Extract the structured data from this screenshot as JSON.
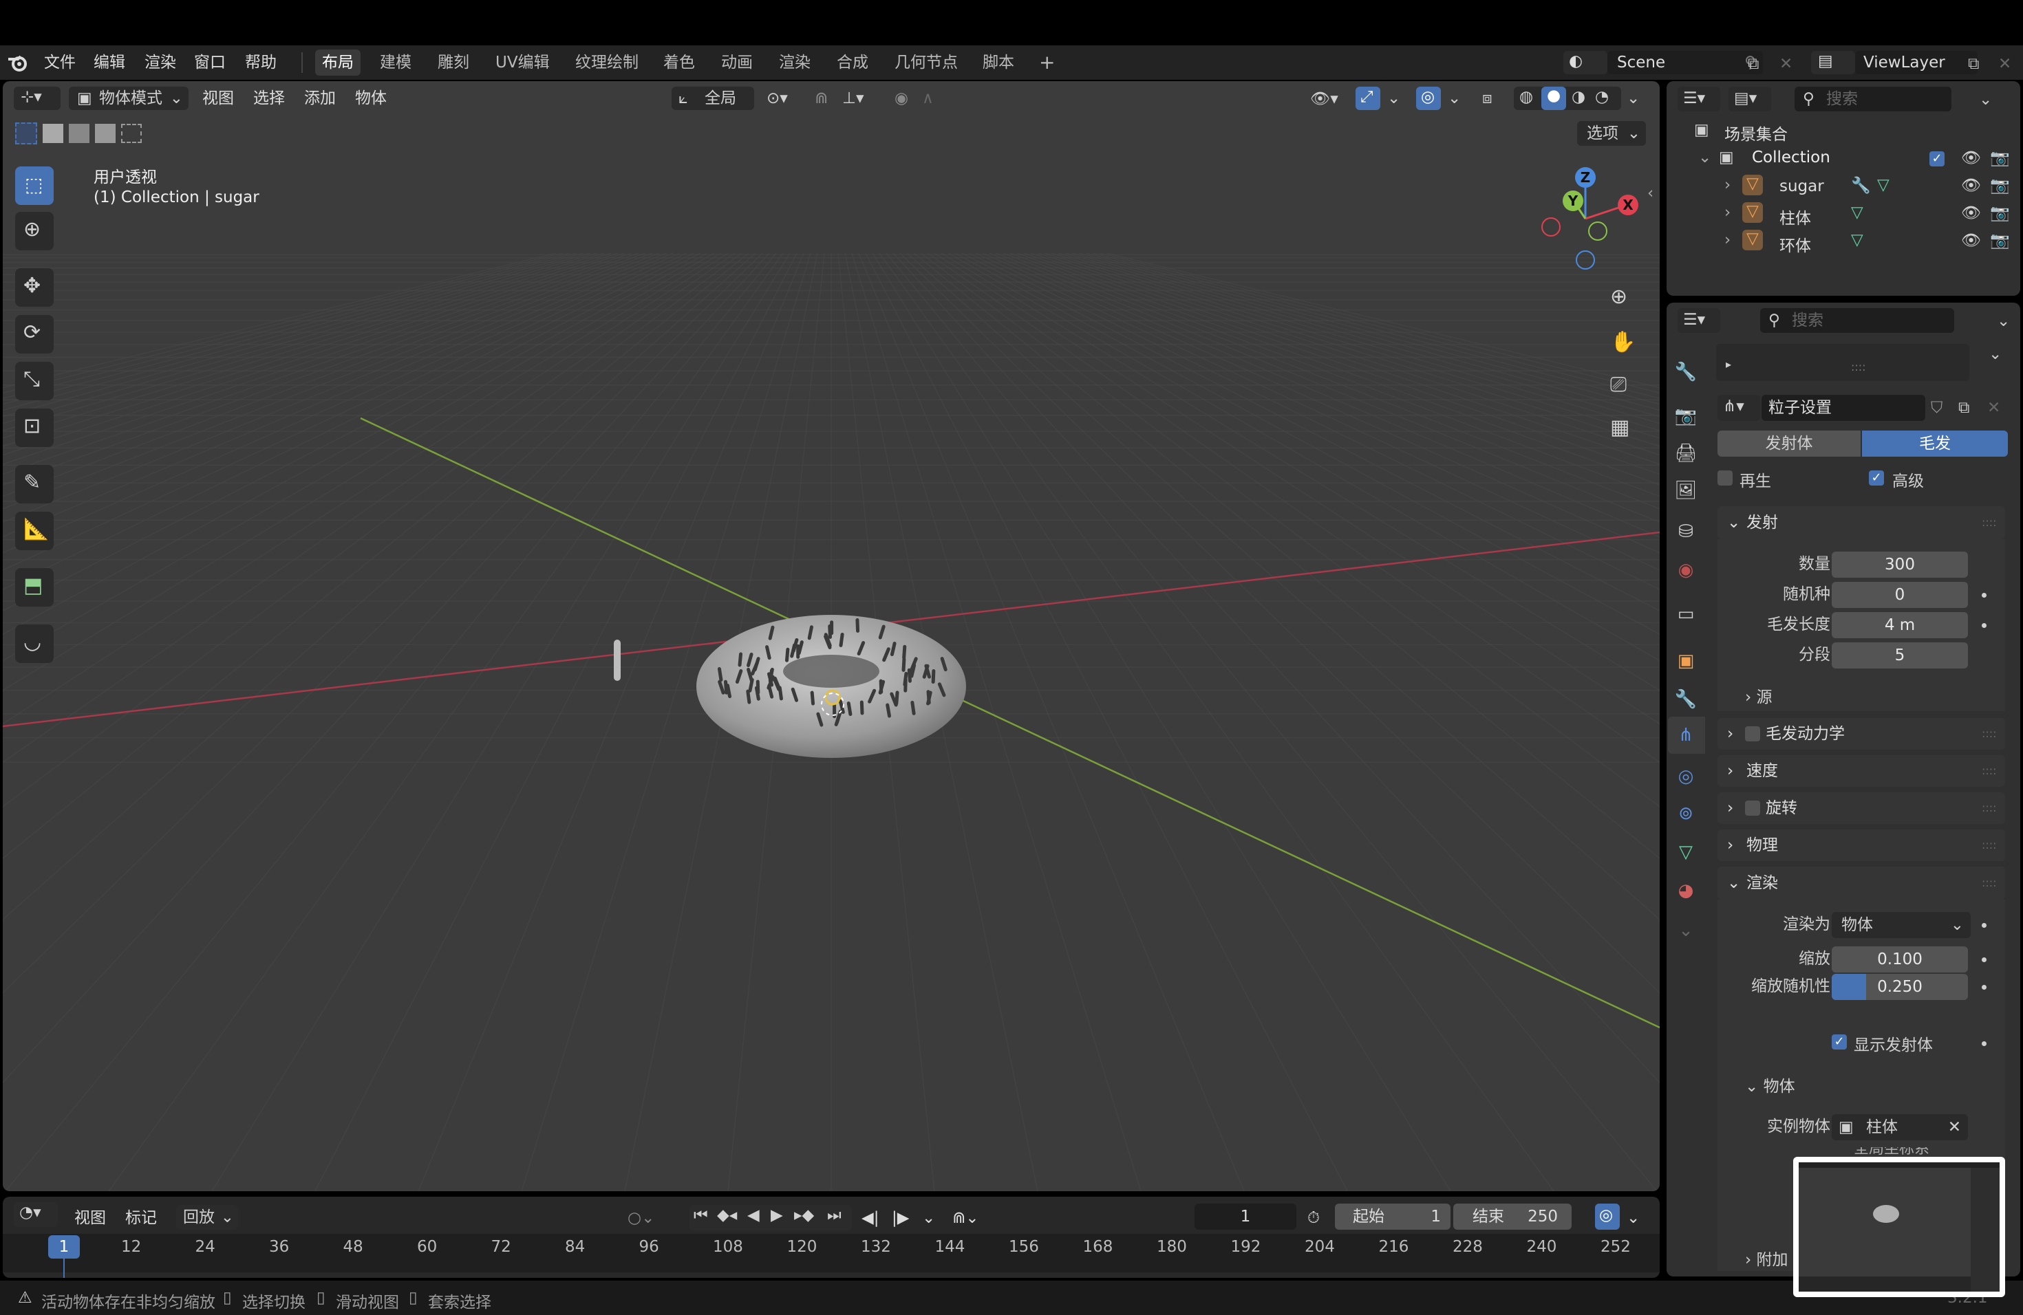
{
  "menubar": {
    "items": [
      "文件",
      "编辑",
      "渲染",
      "窗口",
      "帮助"
    ],
    "workspaces": [
      "布局",
      "建模",
      "雕刻",
      "UV编辑",
      "纹理绘制",
      "着色",
      "动画",
      "渲染",
      "合成",
      "几何节点",
      "脚本"
    ],
    "add_workspace": "+",
    "scene_name": "Scene",
    "view_layer": "ViewLayer"
  },
  "viewport_header": {
    "mode": "物体模式",
    "menus": [
      "视图",
      "选择",
      "添加",
      "物体"
    ],
    "transform_orientation": "全局",
    "options": "选项"
  },
  "viewport": {
    "perspective_label": "用户透视",
    "collection_label": "(1) Collection | sugar",
    "axis_x": "X",
    "axis_y": "Y",
    "axis_z": "Z"
  },
  "outliner": {
    "search_placeholder": "搜索",
    "scene_collection": "场景集合",
    "collection": "Collection",
    "objects": [
      "sugar",
      "柱体",
      "环体"
    ]
  },
  "properties": {
    "search_placeholder": "搜索",
    "particle_settings": "粒子设置",
    "tab_emitter": "发射体",
    "tab_hair": "毛发",
    "regrow": "再生",
    "advanced": "高级",
    "emission": {
      "title": "发射",
      "count_label": "数量",
      "count": "300",
      "seed_label": "随机种",
      "seed": "0",
      "hair_length_label": "毛发长度",
      "hair_length": "4 m",
      "segments_label": "分段",
      "segments": "5",
      "source": "源"
    },
    "hair_dynamics": "毛发动力学",
    "velocity": "速度",
    "rotation": "旋转",
    "physics": "物理",
    "render": {
      "title": "渲染",
      "render_as_label": "渲染为",
      "render_as": "物体",
      "scale_label": "缩放",
      "scale": "0.100",
      "scale_random_label": "缩放随机性",
      "scale_random": "0.250",
      "scale_random_fraction": 0.25,
      "show_emitter": "显示发射体",
      "object_sub": "物体",
      "instance_object_label": "实例物体",
      "instance_object": "柱体",
      "partial": "全局坐标系"
    },
    "extra": "附加"
  },
  "timeline": {
    "menus": [
      "视图",
      "标记",
      "回放"
    ],
    "current_frame": "1",
    "start_label": "起始",
    "start": "1",
    "end_label": "结束",
    "end": "250",
    "ticks": [
      "12",
      "24",
      "36",
      "48",
      "60",
      "72",
      "84",
      "96",
      "108",
      "120",
      "132",
      "144",
      "156",
      "168",
      "180",
      "192",
      "204",
      "216",
      "228",
      "240",
      "252"
    ],
    "playhead": "1"
  },
  "statusbar": {
    "warning": "活动物体存在非均匀缩放",
    "hint_select": "选择切换",
    "hint_pan": "滑动视图",
    "hint_lasso": "套索选择",
    "version": "3.2.1"
  },
  "colors": {
    "accent": "#4772b3",
    "x_axis": "#e04050",
    "y_axis": "#8bc34a",
    "z_axis": "#4a8be0"
  }
}
